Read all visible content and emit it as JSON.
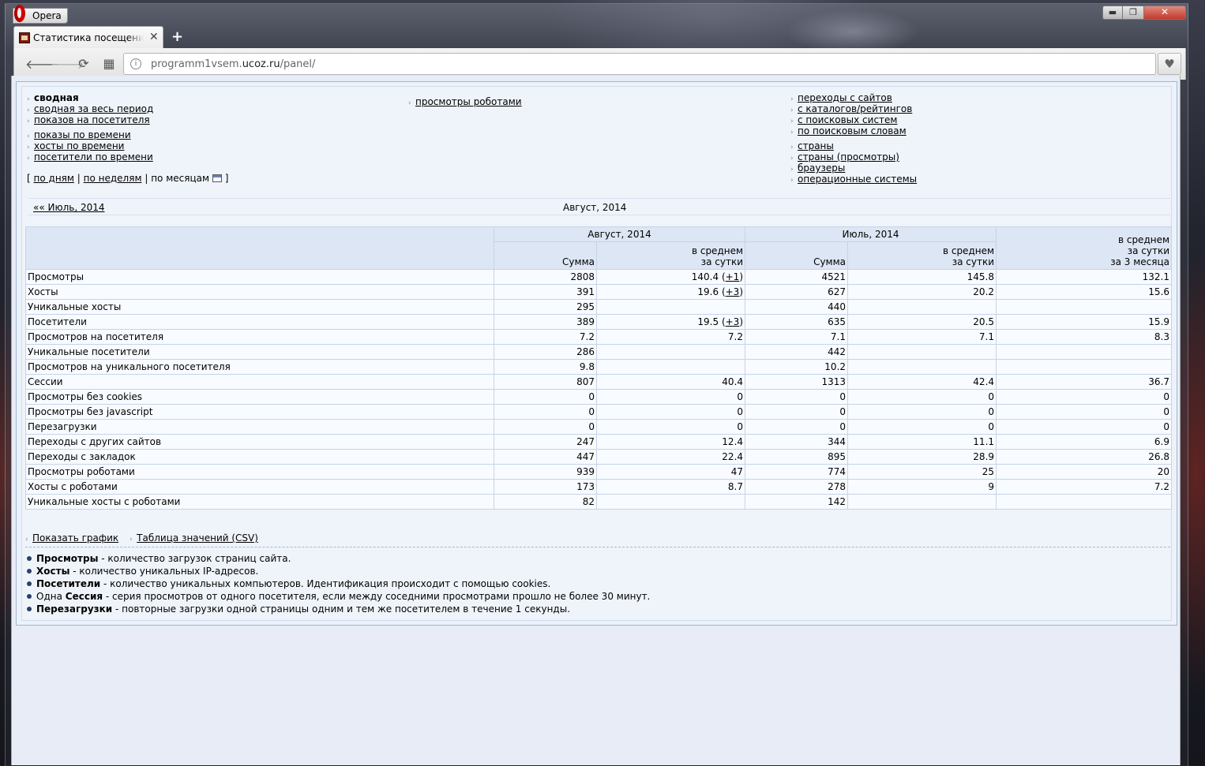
{
  "window": {
    "menu_label": "Opera",
    "min_symbol": "▬",
    "max_symbol": "❐",
    "close_symbol": "✕"
  },
  "tab": {
    "title": "Статистика посещений сайта",
    "close_symbol": "✕",
    "new_tab_symbol": "+"
  },
  "toolbar": {
    "back_symbol": "🡐",
    "forward_symbol": "🡒",
    "reload_symbol": "⟳",
    "speed_dial_symbol": "▦",
    "url_prefix": "programm1vsem.",
    "url_domain": "ucoz.ru",
    "url_path": "/panel/",
    "site_icon_symbol": "i",
    "heart_symbol": "♥"
  },
  "nav": {
    "col1": [
      "сводная",
      "сводная за весь период",
      "показов на посетителя"
    ],
    "col1b": [
      "показы по времени",
      "хосты по времени",
      "посетители по времени"
    ],
    "col2": [
      "просмотры роботами"
    ],
    "col3": [
      "переходы с сайтов",
      "с каталогов/рейтингов",
      "с поисковых систем",
      "по поисковым словам"
    ],
    "col3b": [
      "страны",
      "страны (просмотры)",
      "браузеры",
      "операционные системы"
    ],
    "period": {
      "open": "[",
      "by_days": "по дням",
      "sep": "|",
      "by_weeks": "по неделям",
      "by_months": "по месяцам",
      "close": "]"
    }
  },
  "period_nav": {
    "prev": "«« Июль, 2014",
    "current": "Август, 2014"
  },
  "table": {
    "headers": {
      "aug": "Август, 2014",
      "jul": "Июль, 2014",
      "sum": "Сумма",
      "avg_line1": "в среднем",
      "avg_line2": "за сутки",
      "avg3_line1": "в среднем",
      "avg3_line2": "за сутки",
      "avg3_line3": "за 3 месяца"
    },
    "rows": [
      {
        "label": "Просмотры",
        "aug_sum": "2808",
        "aug_avg": "140.4",
        "aug_delta": "+1",
        "jul_sum": "4521",
        "jul_avg": "145.8",
        "avg3": "132.1"
      },
      {
        "label": "Хосты",
        "aug_sum": "391",
        "aug_avg": "19.6",
        "aug_delta": "+3",
        "jul_sum": "627",
        "jul_avg": "20.2",
        "avg3": "15.6"
      },
      {
        "label": "Уникальные хосты",
        "aug_sum": "295",
        "aug_avg": "",
        "aug_delta": "",
        "jul_sum": "440",
        "jul_avg": "",
        "avg3": ""
      },
      {
        "label": "Посетители",
        "aug_sum": "389",
        "aug_avg": "19.5",
        "aug_delta": "+3",
        "jul_sum": "635",
        "jul_avg": "20.5",
        "avg3": "15.9"
      },
      {
        "label": "Просмотров на посетителя",
        "aug_sum": "7.2",
        "aug_avg": "7.2",
        "aug_delta": "",
        "jul_sum": "7.1",
        "jul_avg": "7.1",
        "avg3": "8.3"
      },
      {
        "label": "Уникальные посетители",
        "aug_sum": "286",
        "aug_avg": "",
        "aug_delta": "",
        "jul_sum": "442",
        "jul_avg": "",
        "avg3": ""
      },
      {
        "label": "Просмотров на уникального посетителя",
        "aug_sum": "9.8",
        "aug_avg": "",
        "aug_delta": "",
        "jul_sum": "10.2",
        "jul_avg": "",
        "avg3": ""
      },
      {
        "label": "Сессии",
        "aug_sum": "807",
        "aug_avg": "40.4",
        "aug_delta": "",
        "jul_sum": "1313",
        "jul_avg": "42.4",
        "avg3": "36.7"
      },
      {
        "label": "Просмотры без cookies",
        "aug_sum": "0",
        "aug_avg": "0",
        "aug_delta": "",
        "jul_sum": "0",
        "jul_avg": "0",
        "avg3": "0"
      },
      {
        "label": "Просмотры без javascript",
        "aug_sum": "0",
        "aug_avg": "0",
        "aug_delta": "",
        "jul_sum": "0",
        "jul_avg": "0",
        "avg3": "0"
      },
      {
        "label": "Перезагрузки",
        "aug_sum": "0",
        "aug_avg": "0",
        "aug_delta": "",
        "jul_sum": "0",
        "jul_avg": "0",
        "avg3": "0"
      },
      {
        "label": "Переходы с других сайтов",
        "aug_sum": "247",
        "aug_avg": "12.4",
        "aug_delta": "",
        "jul_sum": "344",
        "jul_avg": "11.1",
        "avg3": "6.9"
      },
      {
        "label": "Переходы с закладок",
        "aug_sum": "447",
        "aug_avg": "22.4",
        "aug_delta": "",
        "jul_sum": "895",
        "jul_avg": "28.9",
        "avg3": "26.8"
      },
      {
        "label": "Просмотры роботами",
        "aug_sum": "939",
        "aug_avg": "47",
        "aug_delta": "",
        "jul_sum": "774",
        "jul_avg": "25",
        "avg3": "20"
      },
      {
        "label": "Хосты с роботами",
        "aug_sum": "173",
        "aug_avg": "8.7",
        "aug_delta": "",
        "jul_sum": "278",
        "jul_avg": "9",
        "avg3": "7.2"
      },
      {
        "label": "Уникальные хосты с роботами",
        "aug_sum": "82",
        "aug_avg": "",
        "aug_delta": "",
        "jul_sum": "142",
        "jul_avg": "",
        "avg3": ""
      }
    ]
  },
  "footer": {
    "show_chart": "Показать график",
    "csv_table": "Таблица значений (CSV)"
  },
  "legend": [
    {
      "pre": "",
      "term": "Просмотры",
      "desc": " - количество загрузок страниц сайта."
    },
    {
      "pre": "",
      "term": "Хосты",
      "desc": " - количество уникальных IP-адресов."
    },
    {
      "pre": "",
      "term": "Посетители",
      "desc": " - количество уникальных компьютеров. Идентификация происходит с помощью cookies."
    },
    {
      "pre": "Одна ",
      "term": "Сессия",
      "desc": " - серия просмотров от одного посетителя, если между соседними просмотрами прошло не более 30 минут."
    },
    {
      "pre": "",
      "term": "Перезагрузки",
      "desc": " - повторные загрузки одной страницы одним и тем же посетителем в течение 1 секунды."
    }
  ]
}
